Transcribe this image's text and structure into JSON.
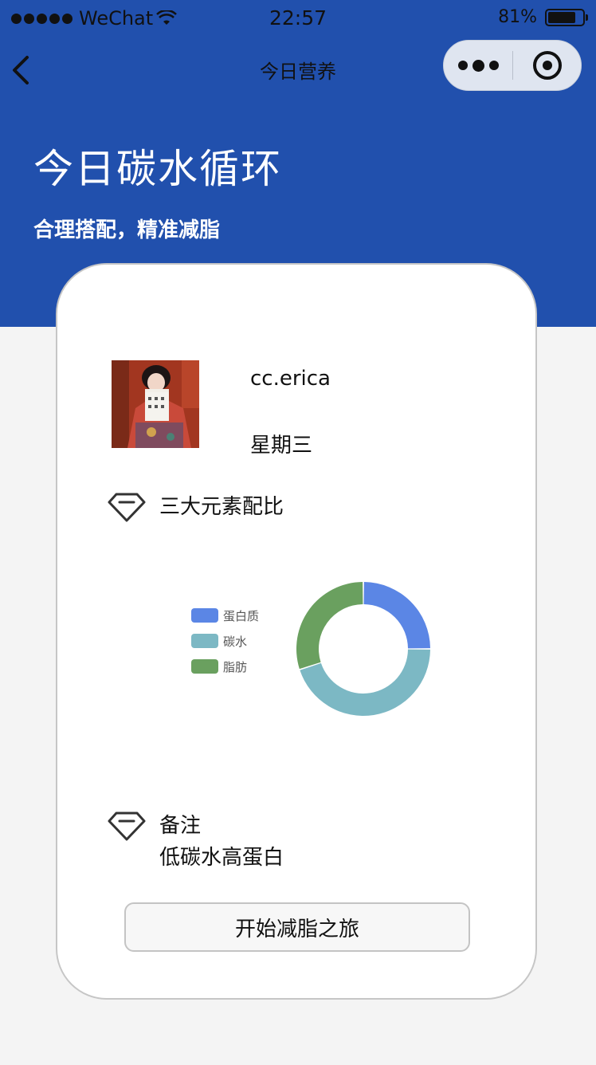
{
  "status_bar": {
    "carrier": "WeChat",
    "time": "22:57",
    "battery": "81%",
    "battery_level": 0.81
  },
  "nav": {
    "title": "今日营养",
    "icons": {
      "back": "chevron-left-icon",
      "more": "more-dots-icon",
      "close": "target-icon"
    }
  },
  "hero": {
    "title": "今日碳水循环",
    "subtitle": "合理搭配，精准减脂"
  },
  "profile": {
    "username": "cc.erica",
    "weekday": "星期三"
  },
  "ratio_section": {
    "label": "三大元素配比"
  },
  "chart_data": {
    "type": "pie",
    "donut": true,
    "categories": [
      "蛋白质",
      "碳水",
      "脂肪"
    ],
    "values": [
      25,
      45,
      30
    ],
    "colors": [
      "#5b86e5",
      "#7cb8c4",
      "#6aa05f"
    ],
    "legend_position": "left"
  },
  "notes_section": {
    "label": "备注",
    "text": "低碳水高蛋白"
  },
  "actions": {
    "start_label": "开始减脂之旅"
  },
  "colors": {
    "header_blue": "#2150ad",
    "page_bg": "#f4f4f4"
  }
}
